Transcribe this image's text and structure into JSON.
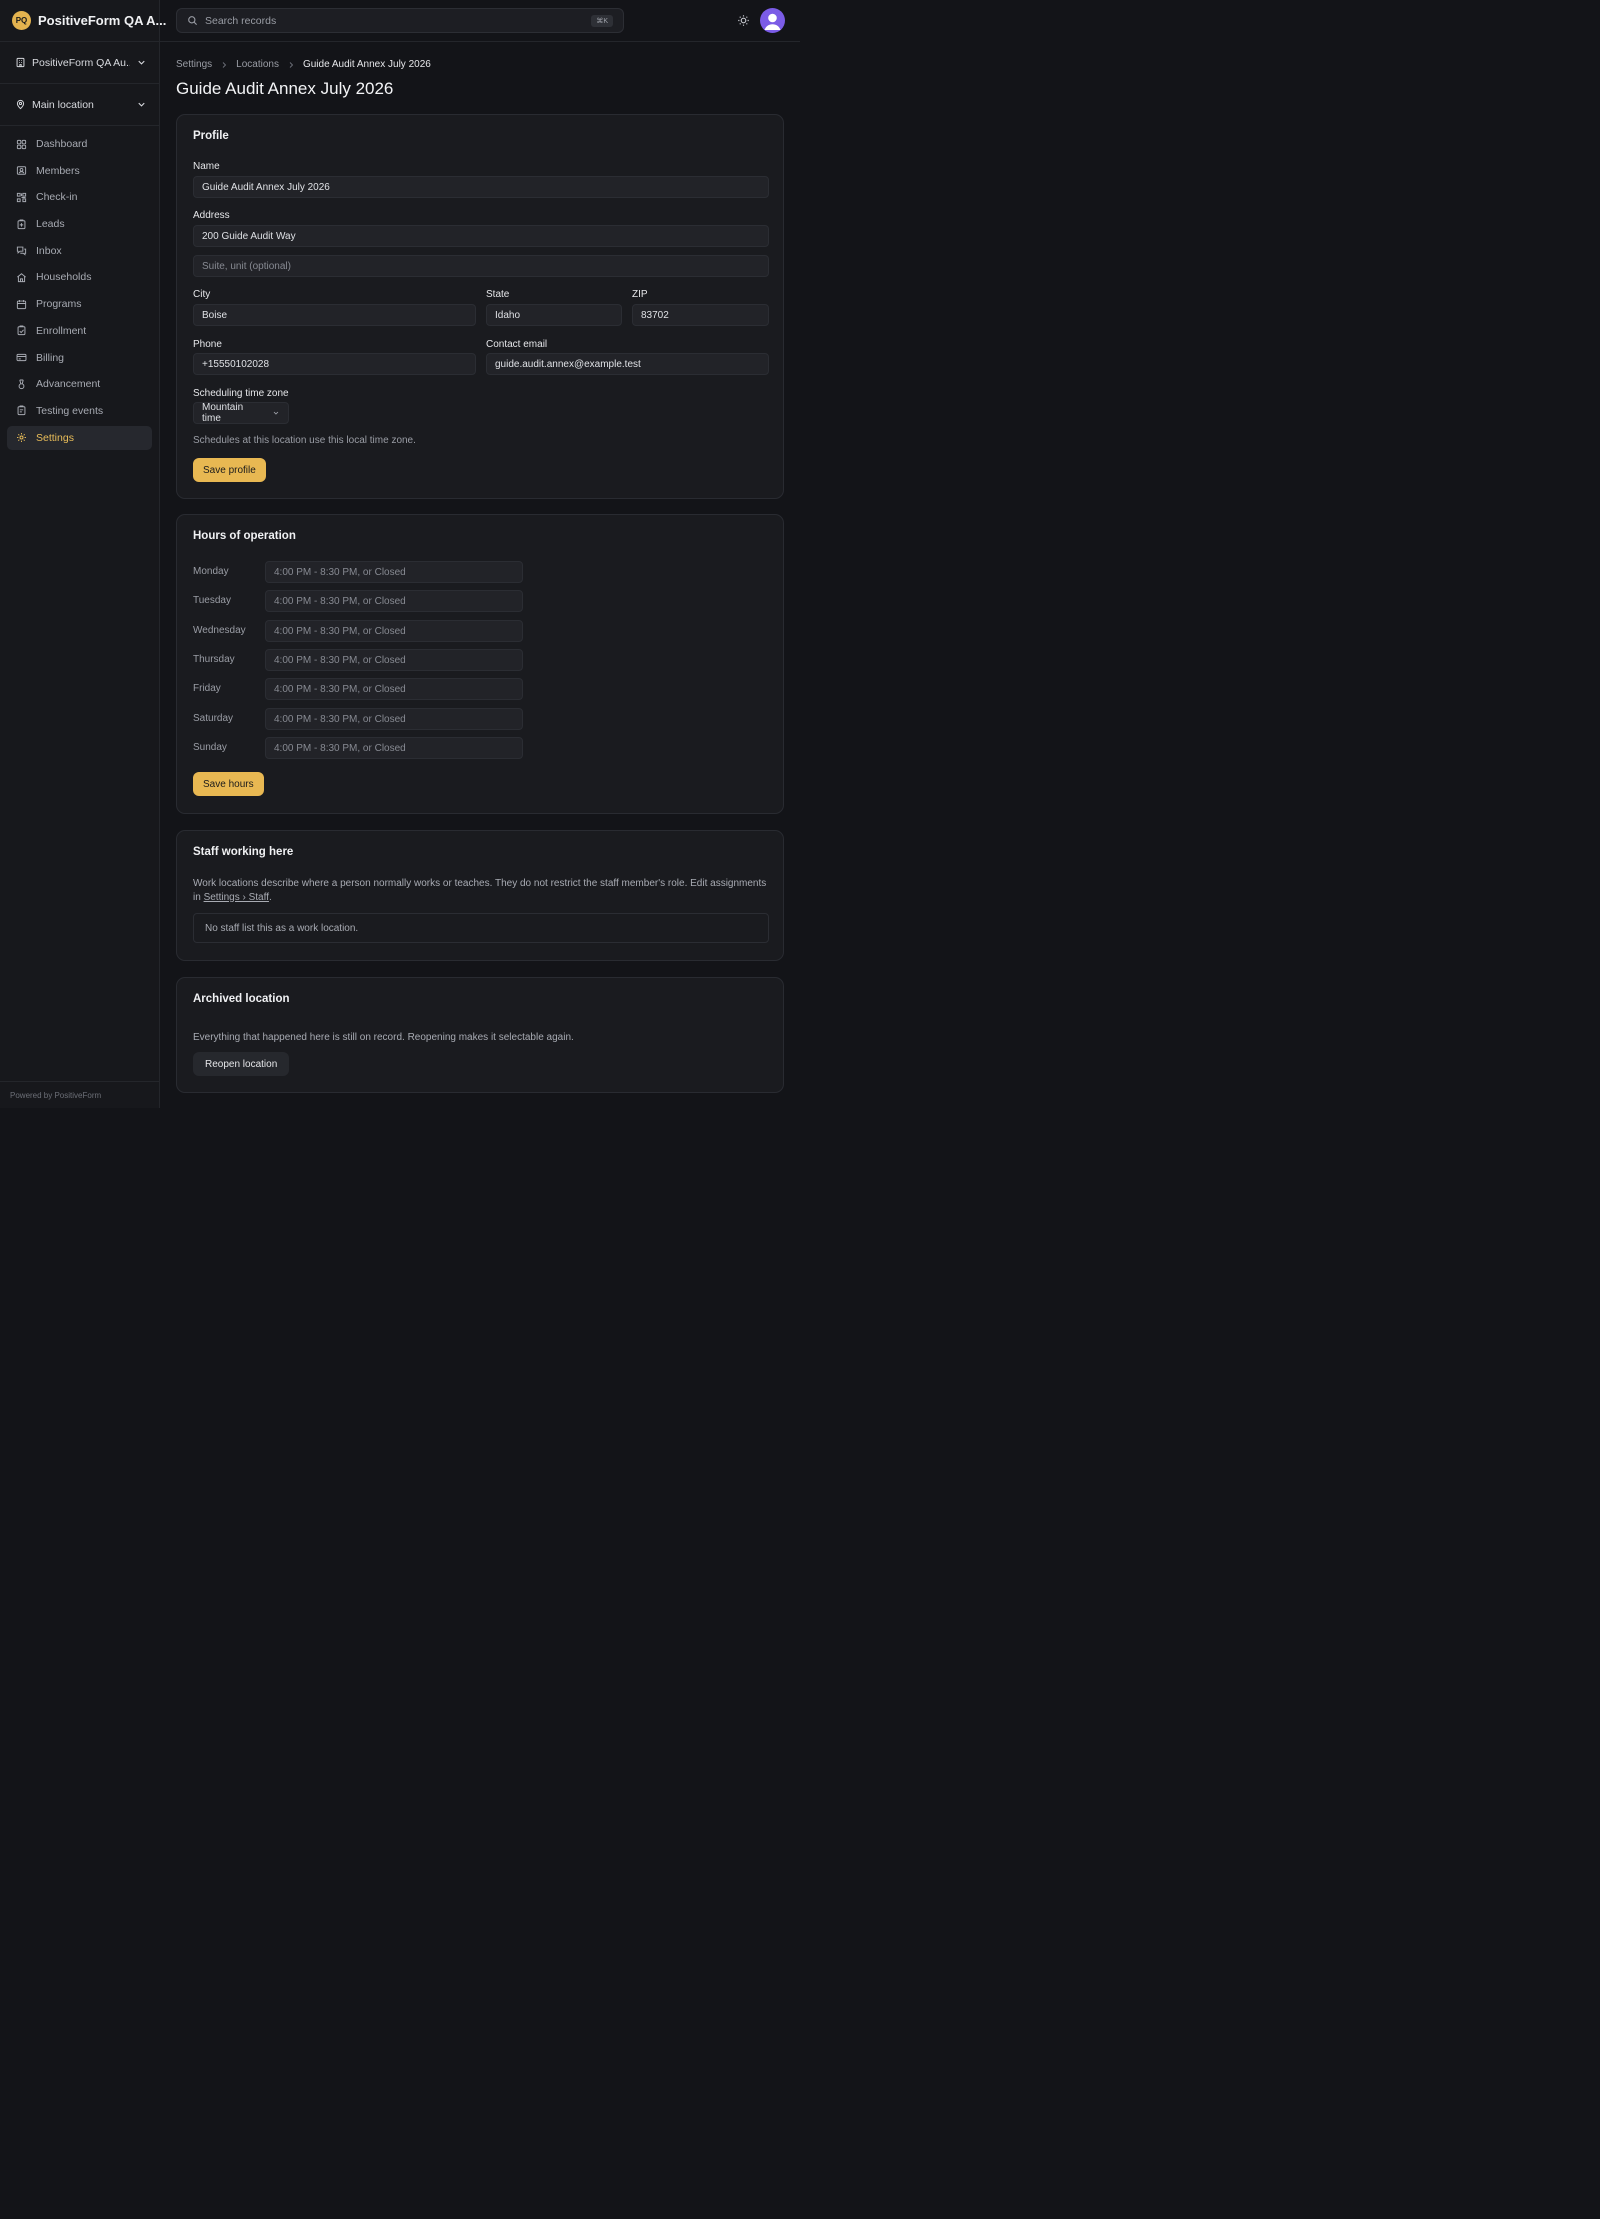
{
  "app": {
    "logo_text": "PQ",
    "name": "PositiveForm QA A...",
    "org_switcher": "PositiveForm QA Au...",
    "location_switcher": "Main location",
    "powered_by": "Powered by PositiveForm"
  },
  "nav": [
    {
      "label": "Dashboard",
      "icon": "dashboard-icon"
    },
    {
      "label": "Members",
      "icon": "members-icon"
    },
    {
      "label": "Check-in",
      "icon": "check-in-icon"
    },
    {
      "label": "Leads",
      "icon": "leads-icon"
    },
    {
      "label": "Inbox",
      "icon": "inbox-icon"
    },
    {
      "label": "Households",
      "icon": "households-icon"
    },
    {
      "label": "Programs",
      "icon": "programs-icon"
    },
    {
      "label": "Enrollment",
      "icon": "enrollment-icon"
    },
    {
      "label": "Billing",
      "icon": "billing-icon"
    },
    {
      "label": "Advancement",
      "icon": "advancement-icon"
    },
    {
      "label": "Testing events",
      "icon": "testing-events-icon"
    },
    {
      "label": "Settings",
      "icon": "settings-icon",
      "active": true
    }
  ],
  "search": {
    "placeholder": "Search records",
    "shortcut": "⌘K"
  },
  "breadcrumb": [
    "Settings",
    "Locations",
    "Guide Audit Annex July 2026"
  ],
  "page_title": "Guide Audit Annex July 2026",
  "profile": {
    "title": "Profile",
    "name_label": "Name",
    "name_value": "Guide Audit Annex July 2026",
    "address_label": "Address",
    "address_value": "200 Guide Audit Way",
    "address2_placeholder": "Suite, unit (optional)",
    "city_label": "City",
    "city_value": "Boise",
    "state_label": "State",
    "state_value": "Idaho",
    "zip_label": "ZIP",
    "zip_value": "83702",
    "phone_label": "Phone",
    "phone_value": "+15550102028",
    "email_label": "Contact email",
    "email_value": "guide.audit.annex@example.test",
    "tz_label": "Scheduling time zone",
    "tz_value": "Mountain time",
    "tz_hint": "Schedules at this location use this local time zone.",
    "save_label": "Save profile"
  },
  "hours": {
    "title": "Hours of operation",
    "placeholder": "4:00 PM - 8:30 PM, or Closed",
    "days": [
      "Monday",
      "Tuesday",
      "Wednesday",
      "Thursday",
      "Friday",
      "Saturday",
      "Sunday"
    ],
    "save_label": "Save hours"
  },
  "staff": {
    "title": "Staff working here",
    "description_before": "Work locations describe where a person normally works or teaches. They do not restrict the staff member's role. Edit assignments in ",
    "link_label": "Settings › Staff",
    "description_after": ".",
    "empty_text": "No staff list this as a work location."
  },
  "archived": {
    "title": "Archived location",
    "description": "Everything that happened here is still on record. Reopening makes it selectable again.",
    "reopen_label": "Reopen location"
  },
  "colors": {
    "accent": "#e8b852",
    "background": "#131418",
    "card": "#1a1b1f",
    "avatar": "#7b5ce6"
  }
}
